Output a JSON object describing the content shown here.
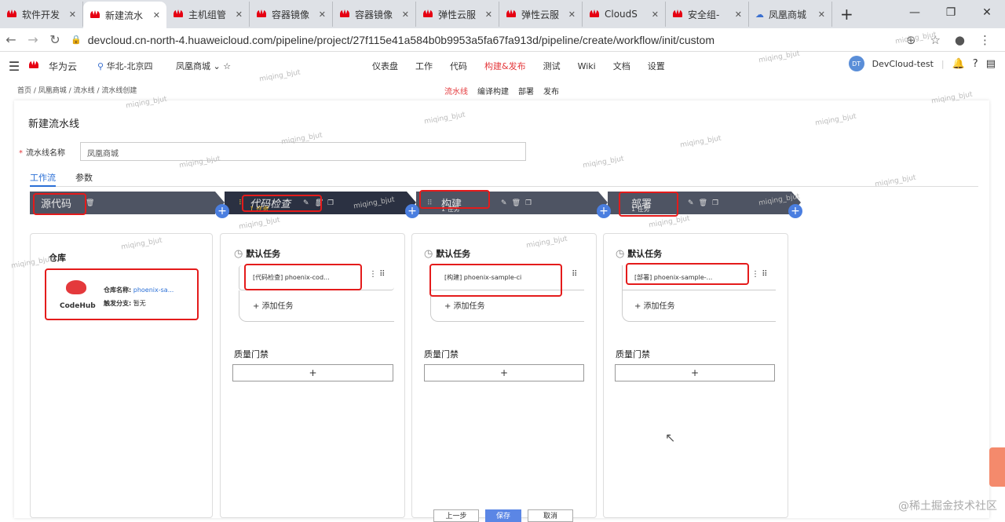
{
  "tabs": [
    {
      "label": "软件开发"
    },
    {
      "label": "新建流水"
    },
    {
      "label": "主机组管"
    },
    {
      "label": "容器镜像"
    },
    {
      "label": "容器镜像"
    },
    {
      "label": "弹性云服"
    },
    {
      "label": "弹性云服"
    },
    {
      "label": "CloudS"
    },
    {
      "label": "安全组-"
    },
    {
      "label": "凤凰商城"
    }
  ],
  "address": {
    "url": "devcloud.cn-north-4.huaweicloud.com/pipeline/project/27f115e41a584b0b9953a5fa67fa913d/pipeline/create/workflow/init/custom"
  },
  "header": {
    "brand": "华为云",
    "region": "华北-北京四",
    "project": "凤凰商城",
    "nav": [
      "仪表盘",
      "工作",
      "代码",
      "构建&发布",
      "测试",
      "Wiki",
      "文档",
      "设置"
    ],
    "active_nav": "构建&发布",
    "user_initials": "DT",
    "user": "DevCloud-test"
  },
  "breadcrumb": {
    "items": [
      "首页",
      "凤凰商城",
      "流水线",
      "流水线创建"
    ]
  },
  "subnav": {
    "items": [
      "流水线",
      "编译构建",
      "部署",
      "发布"
    ]
  },
  "page": {
    "title": "新建流水线",
    "name_label": "流水线名称",
    "name_value": "凤凰商城"
  },
  "workflow_tabs": [
    "工作流",
    "参数"
  ],
  "stages": [
    {
      "name": "源代码"
    },
    {
      "name": "代码检查",
      "sub": "1 任务"
    },
    {
      "name": "构建",
      "sub": "1 任务"
    },
    {
      "name": "部署",
      "sub": "1 任务"
    }
  ],
  "source": {
    "title": "仓库",
    "logo": "CodeHub",
    "repo_label": "仓库名称:",
    "repo_value": "phoenix-sa...",
    "branch_label": "触发分支:",
    "branch_value": "暂无"
  },
  "columns": [
    {
      "task_title": "默认任务",
      "task": "[代码检查] phoenix-cod...",
      "add": "+ 添加任务",
      "gate": "质量门禁"
    },
    {
      "task_title": "默认任务",
      "task": "[构建] phoenix-sample-ci",
      "add": "+ 添加任务",
      "gate": "质量门禁"
    },
    {
      "task_title": "默认任务",
      "task": "[部署] phoenix-sample-...",
      "add": "+ 添加任务",
      "gate": "质量门禁"
    }
  ],
  "watermark": "miqing_bjut",
  "bottom_buttons": [
    "上一步",
    "保存",
    "取消"
  ],
  "signature": "@稀土掘金技术社区"
}
